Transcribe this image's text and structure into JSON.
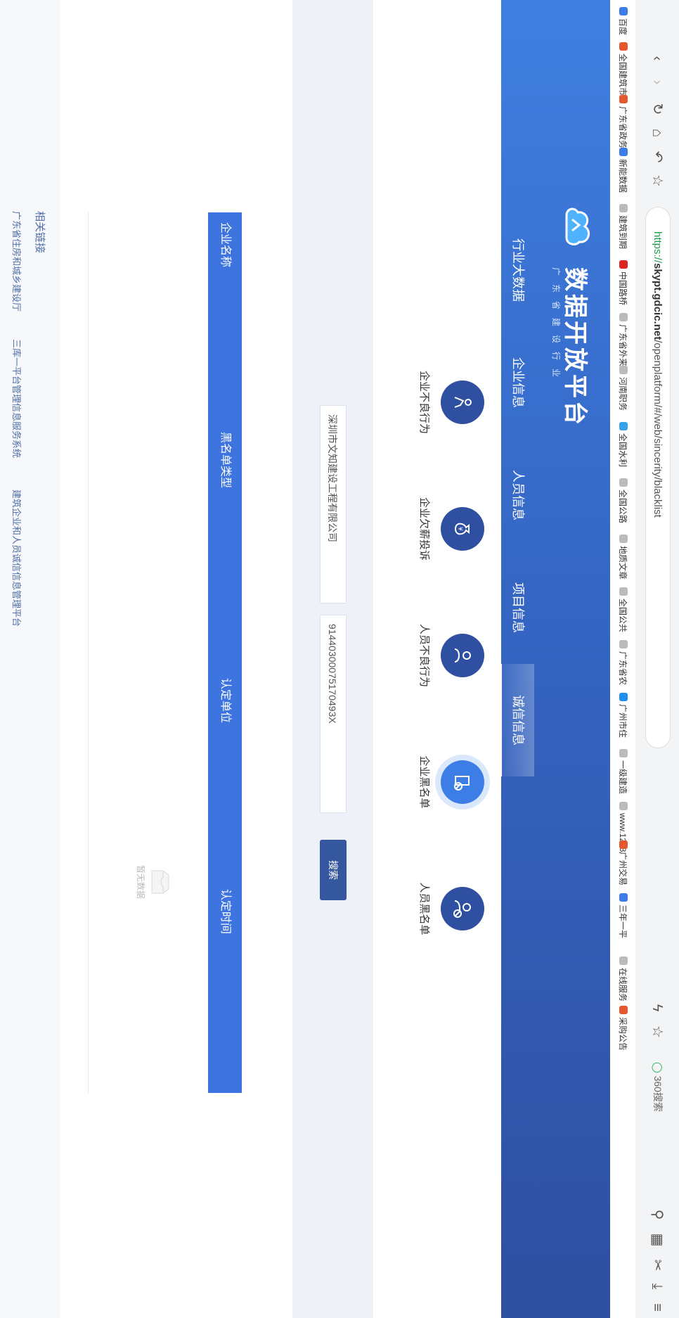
{
  "browser": {
    "url_scheme": "https://",
    "url_host": "skypt.gdcic.net",
    "url_path": "/openplatform/#/web/sincerity/blacklist",
    "search_engine": "360搜索",
    "bookmarks": [
      "百度",
      "全国建筑市",
      "广东省政务",
      "新能数据",
      "建筑到期",
      "中国路桥",
      "广东省外来",
      "河南职务",
      "全国水利",
      "全国公路",
      "地质文章",
      "全国公共",
      "广东省农",
      "广州市住",
      "一级建造",
      "www.1233",
      "广州交易",
      "三年一平",
      "在线服务",
      "采购公告"
    ]
  },
  "header": {
    "logo_title": "数据开放平台",
    "logo_subtitle": "广东省建设行业",
    "nav": [
      "行业大数据",
      "企业信息",
      "人员信息",
      "项目信息",
      "诚信信息"
    ],
    "active_nav": 4
  },
  "categories": [
    {
      "label": "企业不良行为",
      "icon": "person-alert-icon"
    },
    {
      "label": "企业欠薪投诉",
      "icon": "money-bag-icon"
    },
    {
      "label": "人员不良行为",
      "icon": "person-warning-icon"
    },
    {
      "label": "企业黑名单",
      "icon": "building-ban-icon"
    },
    {
      "label": "人员黑名单",
      "icon": "person-ban-icon"
    }
  ],
  "active_category": 3,
  "search": {
    "company_name": "深圳市文知建设工程有限公司",
    "credit_code": "91440300075170493X",
    "button": "搜索"
  },
  "table": {
    "columns": [
      "企业名称",
      "黑名单类型",
      "认定单位",
      "认定时间"
    ],
    "empty_text": "暂无数据"
  },
  "footer": {
    "title": "相关链接",
    "links": [
      "广东省住房和城乡建设厅",
      "三库一平台管理信息服务系统",
      "建筑企业和人员诚信信息管理平台"
    ]
  }
}
